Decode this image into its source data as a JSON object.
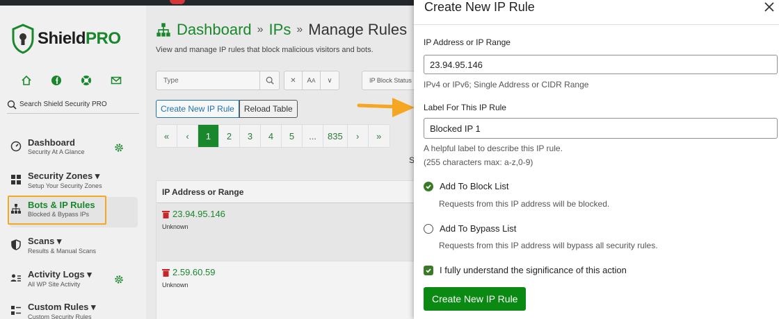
{
  "brand": {
    "shield": "Shield",
    "pro": "PRO"
  },
  "sidebar": {
    "search_placeholder": "Search Shield Security PRO",
    "items": [
      {
        "title": "Dashboard",
        "subtitle": "Security At A Glance"
      },
      {
        "title": "Security Zones ▾",
        "subtitle": "Setup Your Security Zones"
      },
      {
        "title": "Bots & IP Rules",
        "subtitle": "Blocked & Bypass IPs"
      },
      {
        "title": "Scans ▾",
        "subtitle": "Results & Manual Scans"
      },
      {
        "title": "Activity Logs ▾",
        "subtitle": "All WP Site Activity"
      },
      {
        "title": "Custom Rules ▾",
        "subtitle": "Custom Security Rules"
      }
    ]
  },
  "breadcrumb": {
    "root": "Dashboard",
    "mid": "IPs",
    "current": "Manage Rules",
    "sep": "»"
  },
  "subtitle": "View and manage IP rules that block malicious visitors and bots.",
  "filters": {
    "type_placeholder": "Type",
    "block_status": "IP Block Status"
  },
  "buttons": {
    "create": "Create New IP Rule",
    "reload": "Reload Table"
  },
  "pagination": [
    "«",
    "‹",
    "1",
    "2",
    "3",
    "4",
    "5",
    "...",
    "835",
    "›",
    "»"
  ],
  "stub_text": "S",
  "table": {
    "header": "IP Address or Range",
    "rows": [
      {
        "ip": "23.94.95.146",
        "location": "Unknown"
      },
      {
        "ip": "2.59.60.59",
        "location": "Unknown"
      }
    ]
  },
  "modal": {
    "title": "Create New IP Rule",
    "ip_label": "IP Address or IP Range",
    "ip_value": "23.94.95.146",
    "ip_help": "IPv4 or IPv6; Single Address or CIDR Range",
    "rule_label": "Label For This IP Rule",
    "rule_value": "Blocked IP 1",
    "rule_help1": "A helpful label to describe this IP rule.",
    "rule_help2": "(255 characters max: a-z,0-9)",
    "block_label": "Add To Block List",
    "block_desc": "Requests from this IP address will be blocked.",
    "bypass_label": "Add To Bypass List",
    "bypass_desc": "Requests from this IP address will bypass all security rules.",
    "confirm_label": "I fully understand the significance of this action",
    "submit": "Create New IP Rule"
  },
  "colors": {
    "accent": "#19872b",
    "button": "#0a8a12",
    "highlight": "#f5a623"
  }
}
